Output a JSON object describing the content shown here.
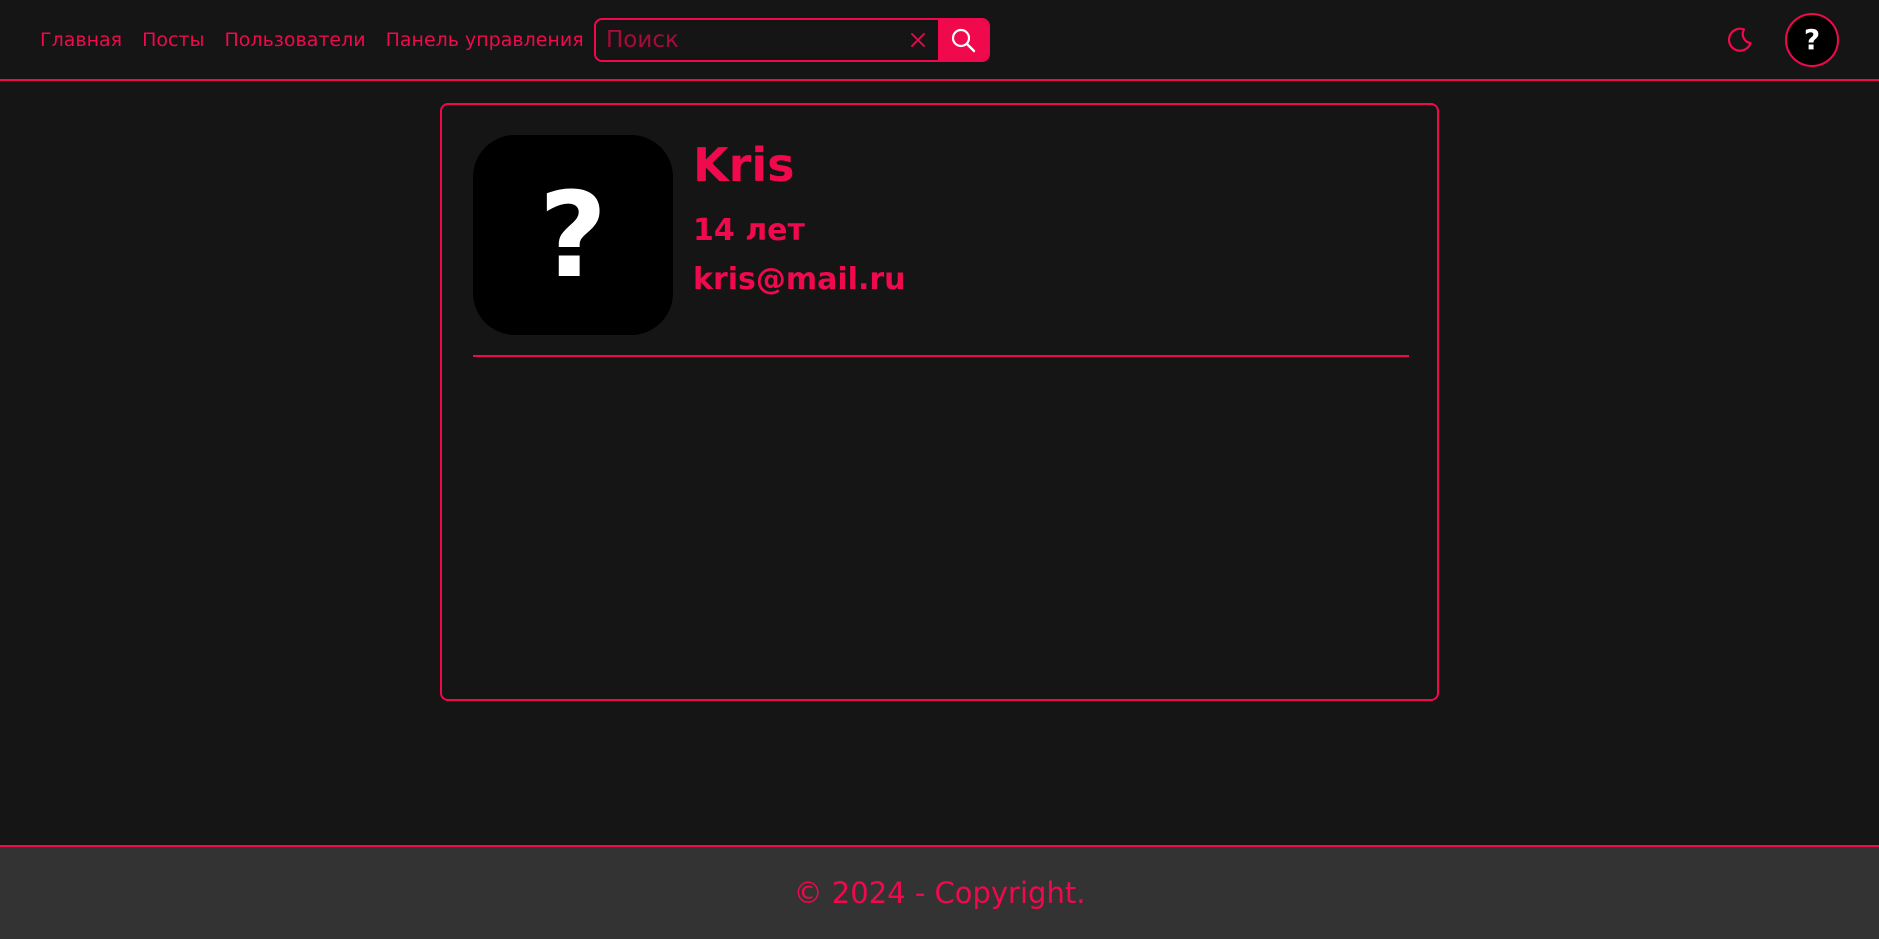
{
  "nav": {
    "items": [
      {
        "label": "Главная"
      },
      {
        "label": "Посты"
      },
      {
        "label": "Пользователи"
      },
      {
        "label": "Панель управления"
      }
    ]
  },
  "search": {
    "placeholder": "Поиск",
    "value": ""
  },
  "header_avatar": {
    "symbol": "?"
  },
  "profile": {
    "avatar_symbol": "?",
    "name": "Kris",
    "age": "14 лет",
    "email": "kris@mail.ru"
  },
  "footer": {
    "text": "© 2024 - Copyright."
  },
  "colors": {
    "accent": "#f0094c",
    "background": "#151515",
    "footer_bg": "#333333",
    "avatar_bg": "#000000"
  },
  "icons": {
    "clear": "close-icon",
    "search": "search-icon",
    "theme": "moon-icon"
  }
}
